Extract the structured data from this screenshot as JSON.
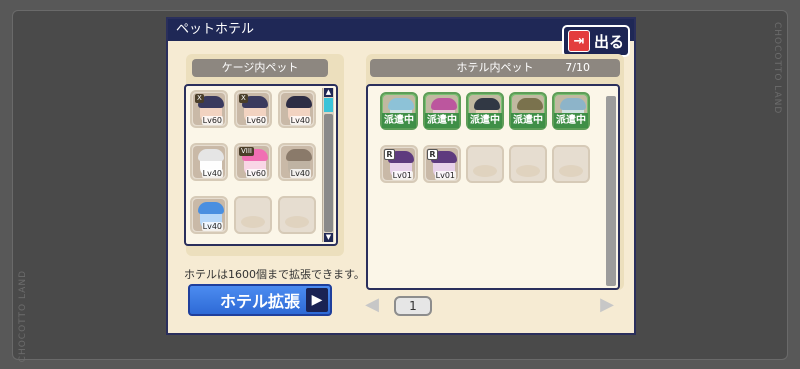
{
  "window": {
    "title": "ペットホテル"
  },
  "exit_button": {
    "label": "出る",
    "icon": "exit-door-icon"
  },
  "watermark": {
    "text": "CHOCOTTO LAND"
  },
  "cage": {
    "header": "ケージ内ペット",
    "pets": [
      {
        "lv": "Lv60",
        "rank": "X",
        "rarity": "",
        "hair": "#3a3a5e",
        "face": "#f2d3c1"
      },
      {
        "lv": "Lv60",
        "rank": "X",
        "rarity": "",
        "hair": "#3a3a5e",
        "face": "#f2d3c1"
      },
      {
        "lv": "Lv40",
        "rank": "",
        "rarity": "",
        "hair": "#2d2d45",
        "face": "#f2d3c1"
      },
      {
        "lv": "Lv40",
        "rank": "",
        "rarity": "",
        "hair": "#e5e5e5",
        "face": "#fefefe"
      },
      {
        "lv": "Lv60",
        "rank": "VIII",
        "rarity": "",
        "hair": "#f06fb3",
        "face": "#f9d6e6"
      },
      {
        "lv": "Lv40",
        "rank": "",
        "rarity": "",
        "hair": "#8a7a6a",
        "face": "#bfb3a3"
      },
      {
        "lv": "Lv40",
        "rank": "",
        "rarity": "",
        "hair": "#4a8fe0",
        "face": "#b8d8f8"
      }
    ],
    "empty_slots": 2,
    "info_text": "ホテルは1600個まで拡張できます。",
    "expand_button": "ホテル拡張"
  },
  "hotel": {
    "header": "ホテル内ペット",
    "count": "7/10",
    "dispatched_label": "派遣中",
    "pets": [
      {
        "lv": "",
        "dispatched": true,
        "rarity": "",
        "hair": "#8fc3e3",
        "face": "#dfe8ef"
      },
      {
        "lv": "",
        "dispatched": true,
        "rarity": "",
        "hair": "#c44ba3",
        "face": "#f3c8de"
      },
      {
        "lv": "",
        "dispatched": true,
        "rarity": "",
        "hair": "#2a2a40",
        "face": "#f2d3c1"
      },
      {
        "lv": "",
        "dispatched": true,
        "rarity": "",
        "hair": "#7a6a4a",
        "face": "#c8b99a"
      },
      {
        "lv": "",
        "dispatched": true,
        "rarity": "",
        "hair": "#8fb3d3",
        "face": "#dbe6ef"
      },
      {
        "lv": "Lv01",
        "dispatched": false,
        "rarity": "R",
        "hair": "#5e3b7e",
        "face": "#e8d2ea"
      },
      {
        "lv": "Lv01",
        "dispatched": false,
        "rarity": "R",
        "hair": "#5e3b7e",
        "face": "#e8d2ea"
      }
    ],
    "empty_slots": 3
  },
  "pagination": {
    "current": "1",
    "prev_icon": "chevron-left-icon",
    "next_icon": "chevron-right-icon"
  }
}
